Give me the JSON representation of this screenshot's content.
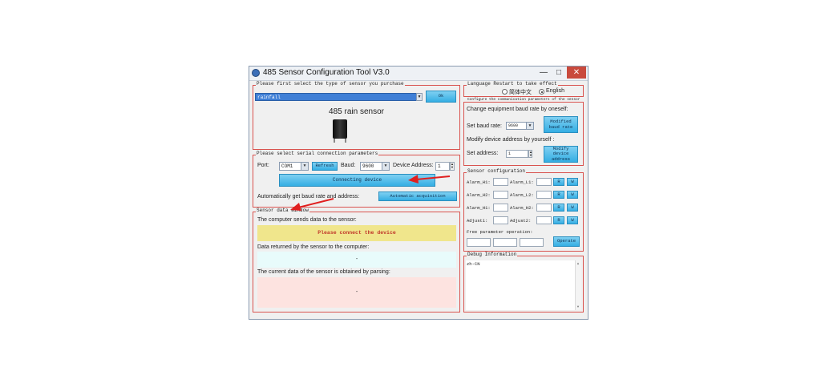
{
  "window": {
    "title": "485 Sensor Configuration Tool V3.0",
    "minimize": "—",
    "maximize": "□",
    "close": "✕"
  },
  "sensor_type": {
    "group_title": "Please first select the type of sensor you purchase",
    "selected": "rainfall",
    "ok_label": "Ok",
    "sensor_name": "485 rain sensor"
  },
  "serial": {
    "group_title": "Please select serial connection parameters",
    "port_label": "Port:",
    "port_value": "COM1",
    "refresh_label": "Refresh",
    "baud_label": "Baud:",
    "baud_value": "9600",
    "device_address_label": "Device Address:",
    "device_address_value": "1",
    "connect_label": "Connecting device",
    "auto_label": "Automatically get baud rate and address:",
    "auto_button": "Automatic acquisition"
  },
  "data_window": {
    "group_title": "Sensor data window",
    "sends_label": "The computer sends data to the sensor:",
    "sends_value": "Please connect the device",
    "returned_label": "Data returned by the sensor to the computer:",
    "returned_value": "-",
    "parsed_label": "The current data of the sensor is obtained by parsing:",
    "parsed_value": "-"
  },
  "language": {
    "group_title": "Language Restart to take effect",
    "chinese": "简体中文",
    "english": "English",
    "selected": "English"
  },
  "comm": {
    "group_title": "Configure the communication parameters of the sensor",
    "baud_heading": "Change equipment baud rate by oneself:",
    "set_baud_label": "Set baud rate:",
    "set_baud_value": "9600",
    "modified_baud_button": "Modified baud rate",
    "addr_heading": "Modify device address by yourself :",
    "set_addr_label": "Set address:",
    "set_addr_value": "1",
    "modify_addr_button": "Modify device address"
  },
  "sensor_config": {
    "group_title": "Sensor configuration",
    "rows": [
      {
        "left": "Alarm_H1:",
        "right": "Alarm_L1:",
        "r": "R",
        "w": "W"
      },
      {
        "left": "Alarm_H2:",
        "right": "Alarm_L2:",
        "r": "R",
        "w": "W"
      },
      {
        "left": "Alarm_H1:",
        "right": "Alarm_H2:",
        "r": "R",
        "w": "W"
      },
      {
        "left": "Adjust1:",
        "right": "Adjust2:",
        "r": "R",
        "w": "W"
      }
    ],
    "free_label": "Free parameter operation:",
    "operate_button": "Operate"
  },
  "debug": {
    "group_title": "Debug Information",
    "text": "zh-CN"
  },
  "colors": {
    "group_border": "#d9534f",
    "button_blue": "#35aee3",
    "send_bg": "#f0e68c",
    "returned_bg": "#e8fbfb",
    "parsed_bg": "#fde3e0",
    "arrow_red": "#e02020"
  }
}
